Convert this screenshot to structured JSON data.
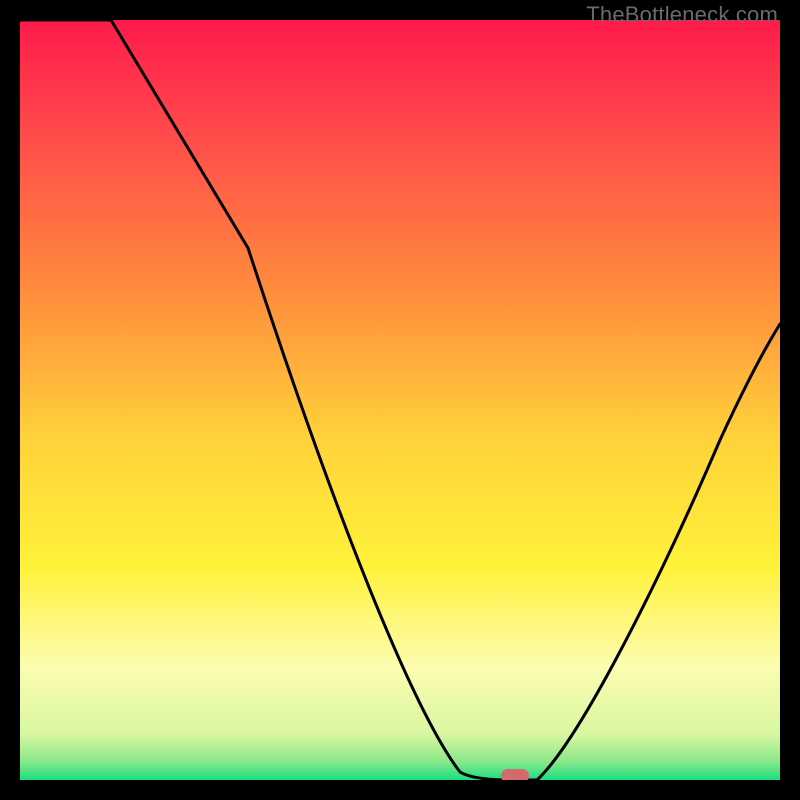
{
  "watermark": "TheBottleneck.com",
  "chart_data": {
    "type": "line",
    "title": "",
    "xlabel": "",
    "ylabel": "",
    "xlim": [
      0,
      100
    ],
    "ylim": [
      0,
      100
    ],
    "grid": false,
    "legend": null,
    "series": [
      {
        "name": "bottleneck-curve",
        "x": [
          0,
          12,
          30,
          55,
          60,
          63,
          68,
          78,
          90,
          100
        ],
        "values": [
          100,
          100,
          70,
          10,
          1,
          0,
          0,
          10,
          35,
          60
        ]
      }
    ],
    "marker": {
      "x": 65,
      "y": 0,
      "color": "#d26b6f"
    },
    "background_gradient": {
      "stops": [
        {
          "pos": 0,
          "color": "#ff1a4b"
        },
        {
          "pos": 0.15,
          "color": "#ff4b4b"
        },
        {
          "pos": 0.35,
          "color": "#ff8a3d"
        },
        {
          "pos": 0.55,
          "color": "#ffd23a"
        },
        {
          "pos": 0.72,
          "color": "#fff23a"
        },
        {
          "pos": 0.85,
          "color": "#fdfcb0"
        },
        {
          "pos": 0.94,
          "color": "#d8f7a0"
        },
        {
          "pos": 0.975,
          "color": "#8ce88a"
        },
        {
          "pos": 1.0,
          "color": "#18df82"
        }
      ]
    }
  }
}
